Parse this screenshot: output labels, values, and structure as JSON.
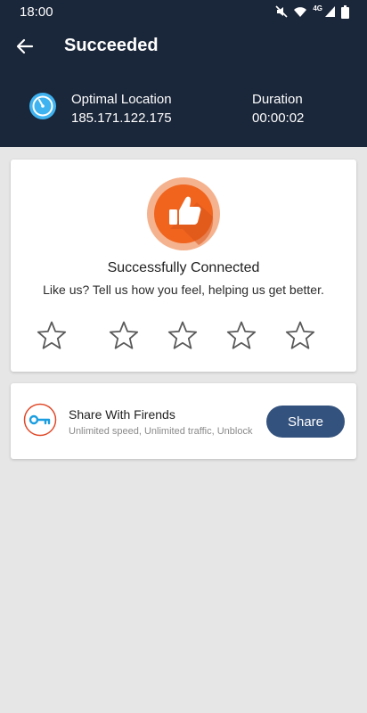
{
  "status_bar": {
    "time": "18:00",
    "icons": [
      "mute-icon",
      "wifi-icon",
      "signal-icon",
      "battery-icon"
    ],
    "network_type": "4G"
  },
  "header": {
    "title": "Succeeded",
    "back_icon": "arrow-left-icon",
    "location_label": "Optimal Location",
    "location_value": "185.171.122.175",
    "duration_label": "Duration",
    "duration_value": "00:00:02",
    "background_color": "#1a2639"
  },
  "rating_card": {
    "icon": "thumbs-up-icon",
    "title": "Successfully Connected",
    "subtitle": "Like us? Tell us how you feel, helping us get better.",
    "stars_total": 5,
    "stars_selected": 0,
    "accent_color": "#f0641e"
  },
  "share_card": {
    "icon": "key-icon",
    "title": "Share With Firends",
    "subtitle": "Unlimited speed, Unlimited traffic, Unblock",
    "button_label": "Share",
    "button_color": "#34527e"
  }
}
